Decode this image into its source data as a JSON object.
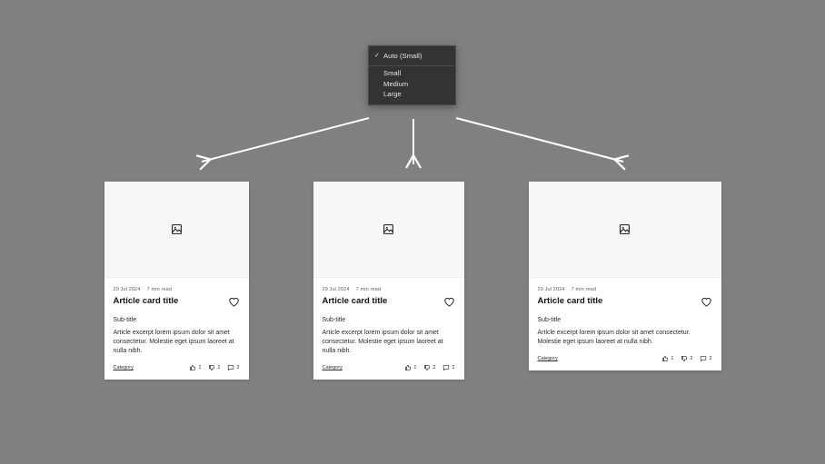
{
  "background_color": "#808080",
  "size_menu": {
    "selected": "Auto (Small)",
    "check_glyph": "✓",
    "auto_item": {
      "label": "Auto (Small)"
    },
    "options": [
      {
        "label": "Small"
      },
      {
        "label": "Medium"
      },
      {
        "label": "Large"
      }
    ]
  },
  "arrows": [
    {
      "name": "arrow-to-small-card",
      "direction": "down-left"
    },
    {
      "name": "arrow-to-medium-card",
      "direction": "down"
    },
    {
      "name": "arrow-to-large-card",
      "direction": "down-right"
    }
  ],
  "cards": [
    {
      "variant": "small",
      "media_icon": "image-placeholder-icon",
      "date": "29 Jul 2024",
      "read_time": "7 min read",
      "title": "Article card title",
      "subtitle": "Sub-title",
      "excerpt": "Article excerpt lorem ipsum dolor sit amet consectetur. Molestie eget ipsum laoreet at nulla nibh.",
      "category": "Category",
      "favorite_icon": "heart-outline-icon",
      "reactions": {
        "likes": "1",
        "dislikes": "2",
        "comments": "2"
      }
    },
    {
      "variant": "medium",
      "media_icon": "image-placeholder-icon",
      "date": "29 Jul 2024",
      "read_time": "7 min read",
      "title": "Article card title",
      "subtitle": "Sub-title",
      "excerpt": "Article excerpt lorem ipsum dolor sit amet consectetur. Molestie eget ipsum laoreet at nulla nibh.",
      "category": "Category",
      "favorite_icon": "heart-outline-icon",
      "reactions": {
        "likes": "1",
        "dislikes": "2",
        "comments": "2"
      }
    },
    {
      "variant": "large",
      "media_icon": "image-placeholder-icon",
      "date": "29 Jul 2024",
      "read_time": "7 min read",
      "title": "Article card title",
      "subtitle": "Sub-title",
      "excerpt": "Article excerpt lorem ipsum dolor sit amet consectetur. Molestie eget ipsum laoreet at nulla nibh.",
      "category": "Category",
      "favorite_icon": "heart-outline-icon",
      "reactions": {
        "likes": "1",
        "dislikes": "2",
        "comments": "2"
      }
    }
  ]
}
